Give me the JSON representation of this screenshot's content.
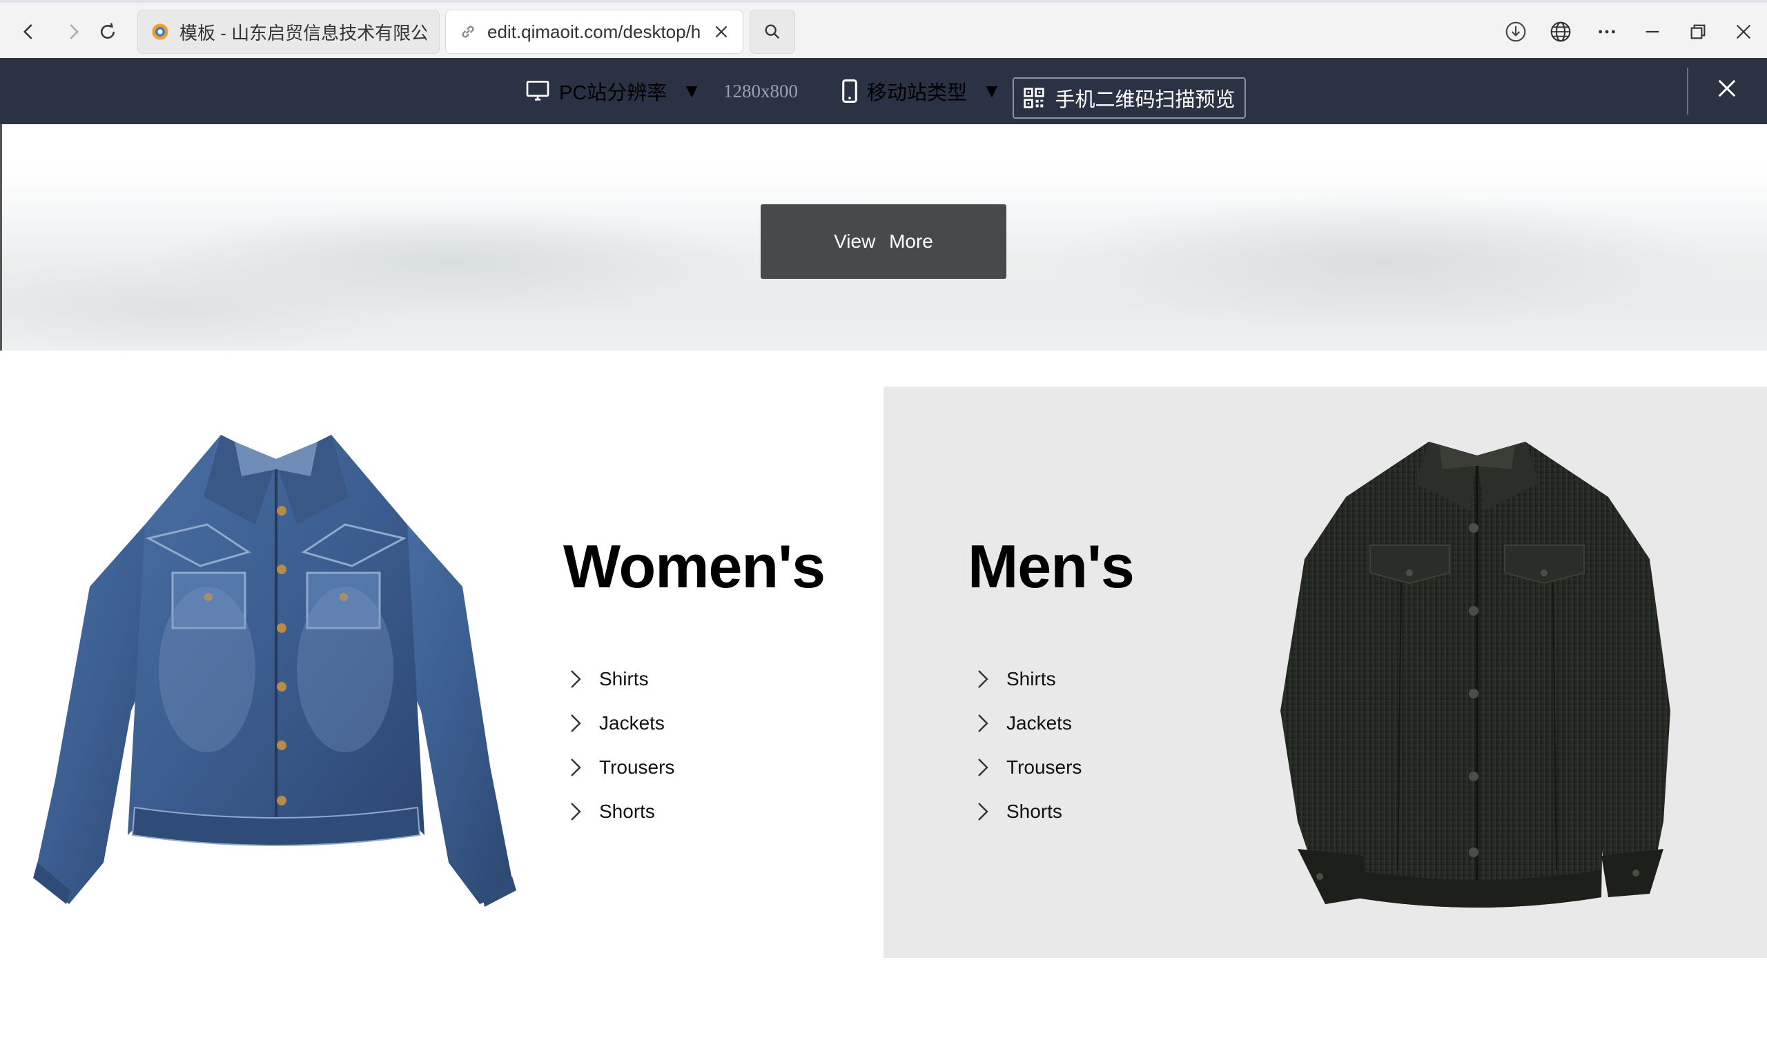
{
  "browser": {
    "tabs": [
      {
        "title": "模板 - 山东启贸信息技术有限公司",
        "active": false
      },
      {
        "title": "edit.qimaoit.com/desktop/h",
        "active": true
      }
    ]
  },
  "editor_toolbar": {
    "pc_label": "PC站分辨率",
    "resolution": "1280x800",
    "mobile_label": "移动站类型",
    "qr_label": "手机二维码扫描预览"
  },
  "banner": {
    "button_label": "View  More"
  },
  "womens": {
    "title": "Women's",
    "items": [
      "Shirts",
      "Jackets",
      "Trousers",
      "Shorts"
    ]
  },
  "mens": {
    "title": "Men's",
    "items": [
      "Shirts",
      "Jackets",
      "Trousers",
      "Shorts"
    ]
  },
  "colors": {
    "toolbar_bg": "#2b3243",
    "button_bg": "#48494b",
    "mens_panel_bg": "#e9e9e9",
    "denim": "#3b5d8f",
    "corduroy": "#232621"
  }
}
